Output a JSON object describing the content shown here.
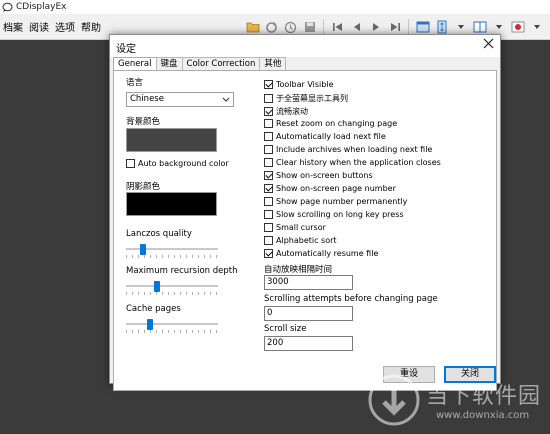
{
  "app": {
    "title": "CDisplayEx",
    "menu": [
      "档案",
      "阅读",
      "选项",
      "帮助"
    ]
  },
  "dialog": {
    "title": "设定",
    "tabs": [
      "General",
      "键盘",
      "Color Correction",
      "其他"
    ],
    "left": {
      "language_label": "语言",
      "language_value": "Chinese",
      "bg_color_label": "背景颜色",
      "bg_color": "#444444",
      "auto_bg_label": "Auto background color",
      "auto_bg_checked": false,
      "shadow_color_label": "阴影颜色",
      "shadow_color": "#000000",
      "lanczos_label": "Lanczos quality",
      "recursion_label": "Maximum recursion depth",
      "cache_label": "Cache pages"
    },
    "options": [
      {
        "label": "Toolbar Visible",
        "checked": true
      },
      {
        "label": "于全萤幕显示工具列",
        "checked": false
      },
      {
        "label": "流畅滚动",
        "checked": true
      },
      {
        "label": "Reset zoom on changing page",
        "checked": false
      },
      {
        "label": "Automatically load next file",
        "checked": false
      },
      {
        "label": "Include archives when loading next file",
        "checked": false
      },
      {
        "label": "Clear history when the application closes",
        "checked": false
      },
      {
        "label": "Show on-screen buttons",
        "checked": true
      },
      {
        "label": "Show on-screen page number",
        "checked": true
      },
      {
        "label": "Show page number permanently",
        "checked": false
      },
      {
        "label": "Slow scrolling on long key press",
        "checked": false
      },
      {
        "label": "Small cursor",
        "checked": false
      },
      {
        "label": "Alphabetic sort",
        "checked": false
      },
      {
        "label": "Automatically resume file",
        "checked": true
      }
    ],
    "slideshow_label": "自动放映相隔时间",
    "slideshow_value": "3000",
    "scroll_attempts_label": "Scrolling attempts before changing page",
    "scroll_attempts_value": "0",
    "scroll_size_label": "Scroll size",
    "scroll_size_value": "200",
    "reset_button": "重设",
    "close_button": "关闭"
  },
  "watermark": {
    "text_cn": "当下软件园",
    "url": "www.downxia.com"
  },
  "colors": {
    "accent": "#0078d7",
    "desktop": "#3b3b3b"
  }
}
